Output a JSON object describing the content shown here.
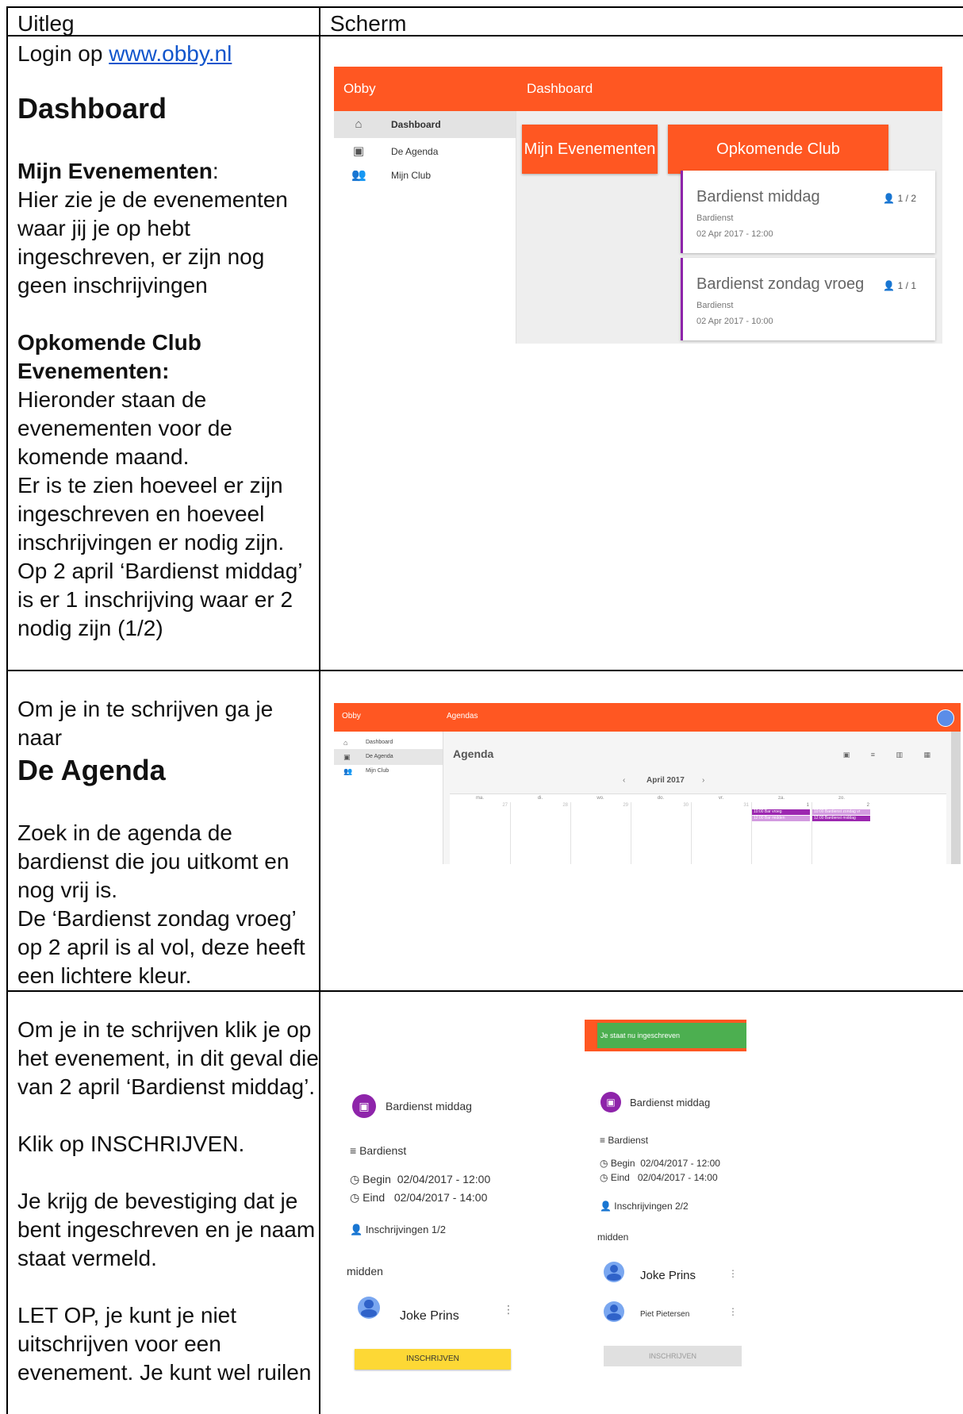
{
  "table": {
    "col_left_header": "Uitleg",
    "col_right_header": "Scherm"
  },
  "row1": {
    "login_prefix": "Login op ",
    "login_link": "www.obby.nl",
    "heading": "Dashboard",
    "mine_label": "Mijn Evenementen",
    "mine_colon": ":",
    "mine_text": "Hier zie je de evenementen waar jij je op hebt ingeschreven, er zijn nog geen inschrijvingen",
    "upcoming_label": "Opkomende Club Evenementen:",
    "upcoming_text_1": "Hieronder staan de evenementen voor de komende maand.",
    "upcoming_text_2": "Er is te zien hoeveel er zijn ingeschreven en hoeveel inschrijvingen er nodig zijn.",
    "upcoming_text_3": "Op 2 april ‘Bardienst middag’ is er 1 inschrijving waar er 2 nodig zijn (1/2)"
  },
  "row2": {
    "intro": "Om je in te schrijven ga je naar",
    "heading": "De Agenda",
    "text_1": "Zoek in de agenda de bardienst die jou uitkomt en nog vrij is.",
    "text_2": "De ‘Bardienst zondag vroeg’ op 2 april is al vol, deze heeft een lichtere kleur."
  },
  "row3": {
    "text_1": "Om je in te schrijven klik je op het evenement, in dit geval die van 2 april ‘Bardienst middag’.",
    "text_2": "Klik op INSCHRIJVEN.",
    "text_3": "Je krijg de bevestiging dat je bent ingeschreven en je naam staat vermeld.",
    "text_4": "LET OP, je kunt je niet uitschrijven voor een evenement. Je kunt wel ruilen"
  },
  "dashboard": {
    "brand": "Obby",
    "title": "Dashboard",
    "nav": [
      "Dashboard",
      "De Agenda",
      "Mijn Club"
    ],
    "mine_header": "Mijn Evenementen",
    "upcoming_header": "Opkomende Club Evenementen",
    "events": [
      {
        "title": "Bardienst middag",
        "type": "Bardienst",
        "datetime": "02 Apr 2017 - 12:00",
        "count": "1 / 2"
      },
      {
        "title": "Bardienst zondag vroeg",
        "type": "Bardienst",
        "datetime": "02 Apr 2017 - 10:00",
        "count": "1 / 1"
      }
    ],
    "colors": {
      "primary": "#ff5722",
      "event_accent": "#8e24aa"
    }
  },
  "agenda": {
    "brand": "Obby",
    "title": "Agendas",
    "nav": [
      "Dashboard",
      "De Agenda",
      "Mijn Club"
    ],
    "heading": "Agenda",
    "month": "April 2017",
    "prev": "‹",
    "next": "›",
    "weekdays": [
      "ma.",
      "di.",
      "wo.",
      "do.",
      "vr.",
      "za.",
      "zo."
    ],
    "day_numbers": [
      "27",
      "28",
      "29",
      "30",
      "31",
      "1",
      "2"
    ],
    "events_sat": [
      "10:00 Bar vroeg",
      "12:00 Bar midden"
    ],
    "events_sun": [
      "10:00 Bardienst zondag vr",
      "12:00 Bardienst middag"
    ],
    "colors": {
      "event": "#9c27b0",
      "event_light": "#d39ae0"
    }
  },
  "detail_before": {
    "title": "Bardienst middag",
    "type": "Bardienst",
    "begin_label": "Begin",
    "begin": "02/04/2017 - 12:00",
    "end_label": "Eind",
    "end": "02/04/2017 - 14:00",
    "registrations": "Inschrijvingen 1/2",
    "section": "midden",
    "people": [
      "Joke Prins"
    ],
    "button": "INSCHRIJVEN"
  },
  "detail_after": {
    "toast": "Je staat nu ingeschreven",
    "title": "Bardienst middag",
    "type": "Bardienst",
    "begin_label": "Begin",
    "begin": "02/04/2017 - 12:00",
    "end_label": "Eind",
    "end": "02/04/2017 - 14:00",
    "registrations": "Inschrijvingen 2/2",
    "section": "midden",
    "people": [
      "Joke Prins",
      "Piet Pietersen"
    ],
    "button": "INSCHRIJVEN",
    "colors": {
      "toast": "#4caf50",
      "button_active": "#fdd835",
      "button_disabled": "#e0e0e0"
    }
  }
}
